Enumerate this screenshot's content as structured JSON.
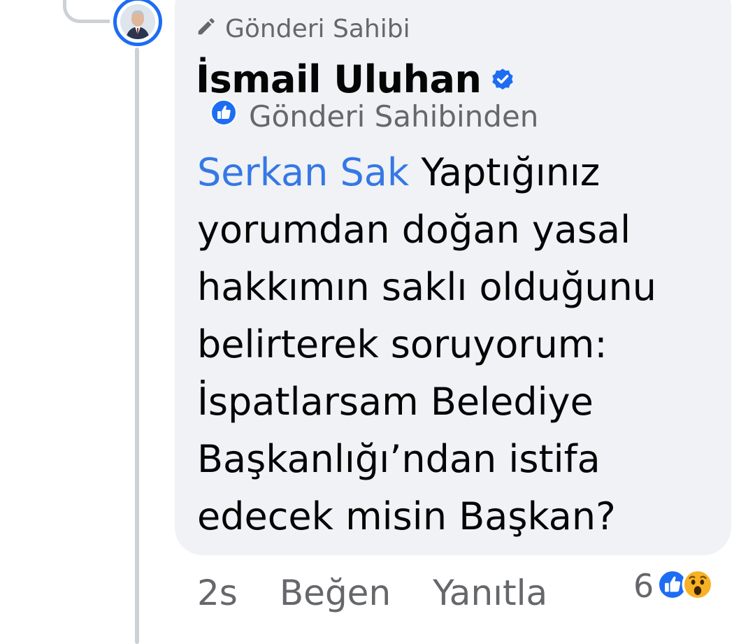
{
  "comment": {
    "badge_label": "Gönderi Sahibi",
    "author_name": "İsmail Uluhan",
    "from_owner_label": "Gönderi Sahibinden",
    "mention": "Serkan Sak",
    "text": " Yaptığınız yorumdan doğan yasal hakkımın saklı olduğunu belirterek soruyorum: İspatlarsam Belediye Başkanlığı’ndan istifa edecek misin Başkan?"
  },
  "actions": {
    "time": "2s",
    "like_label": "Beğen",
    "reply_label": "Yanıtla"
  },
  "reactions": {
    "count": "6",
    "icons": [
      "like-icon",
      "wow-icon"
    ]
  },
  "colors": {
    "accent": "#1d6df2",
    "mention": "#3578e5",
    "bubble": "#f0f2f5",
    "secondary_text": "#65676b",
    "thread_line": "#cdd1d6"
  }
}
